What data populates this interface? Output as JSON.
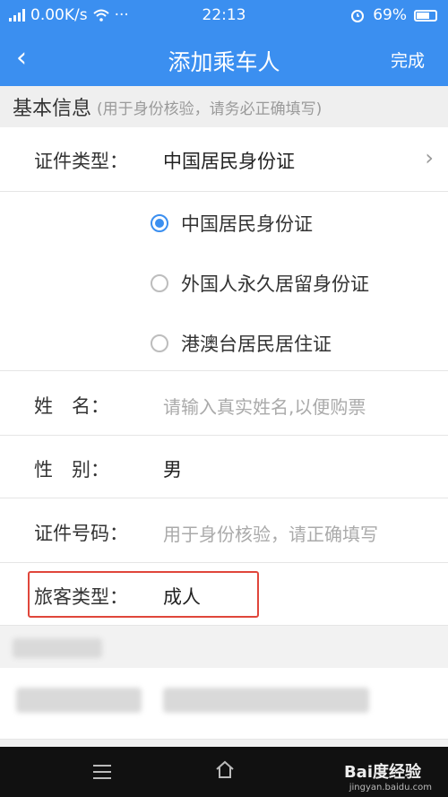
{
  "status": {
    "network": "0.00K/s",
    "dots": "···",
    "time": "22:13",
    "battery": "69%"
  },
  "nav": {
    "back": "‹",
    "title": "添加乘车人",
    "done": "完成"
  },
  "section": {
    "title": "基本信息",
    "hint": "(用于身份核验，请务必正确填写)"
  },
  "id_type": {
    "label": "证件类型：",
    "value": "中国居民身份证",
    "chevron": "›"
  },
  "id_options": [
    {
      "label": "中国居民身份证",
      "selected": true
    },
    {
      "label": "外国人永久居留身份证",
      "selected": false
    },
    {
      "label": "港澳台居民居住证",
      "selected": false
    }
  ],
  "name": {
    "label": "姓　名：",
    "placeholder": "请输入真实姓名,以便购票"
  },
  "gender": {
    "label": "性　别：",
    "value": "男"
  },
  "id_number": {
    "label": "证件号码：",
    "placeholder": "用于身份核验，请正确填写"
  },
  "passenger_type": {
    "label": "旅客类型：",
    "value": "成人"
  },
  "watermark": {
    "text": "Bai度经验",
    "sub": "jingyan.baidu.com"
  },
  "colors": {
    "accent": "#3b8ff0",
    "highlight": "#e0463b"
  }
}
